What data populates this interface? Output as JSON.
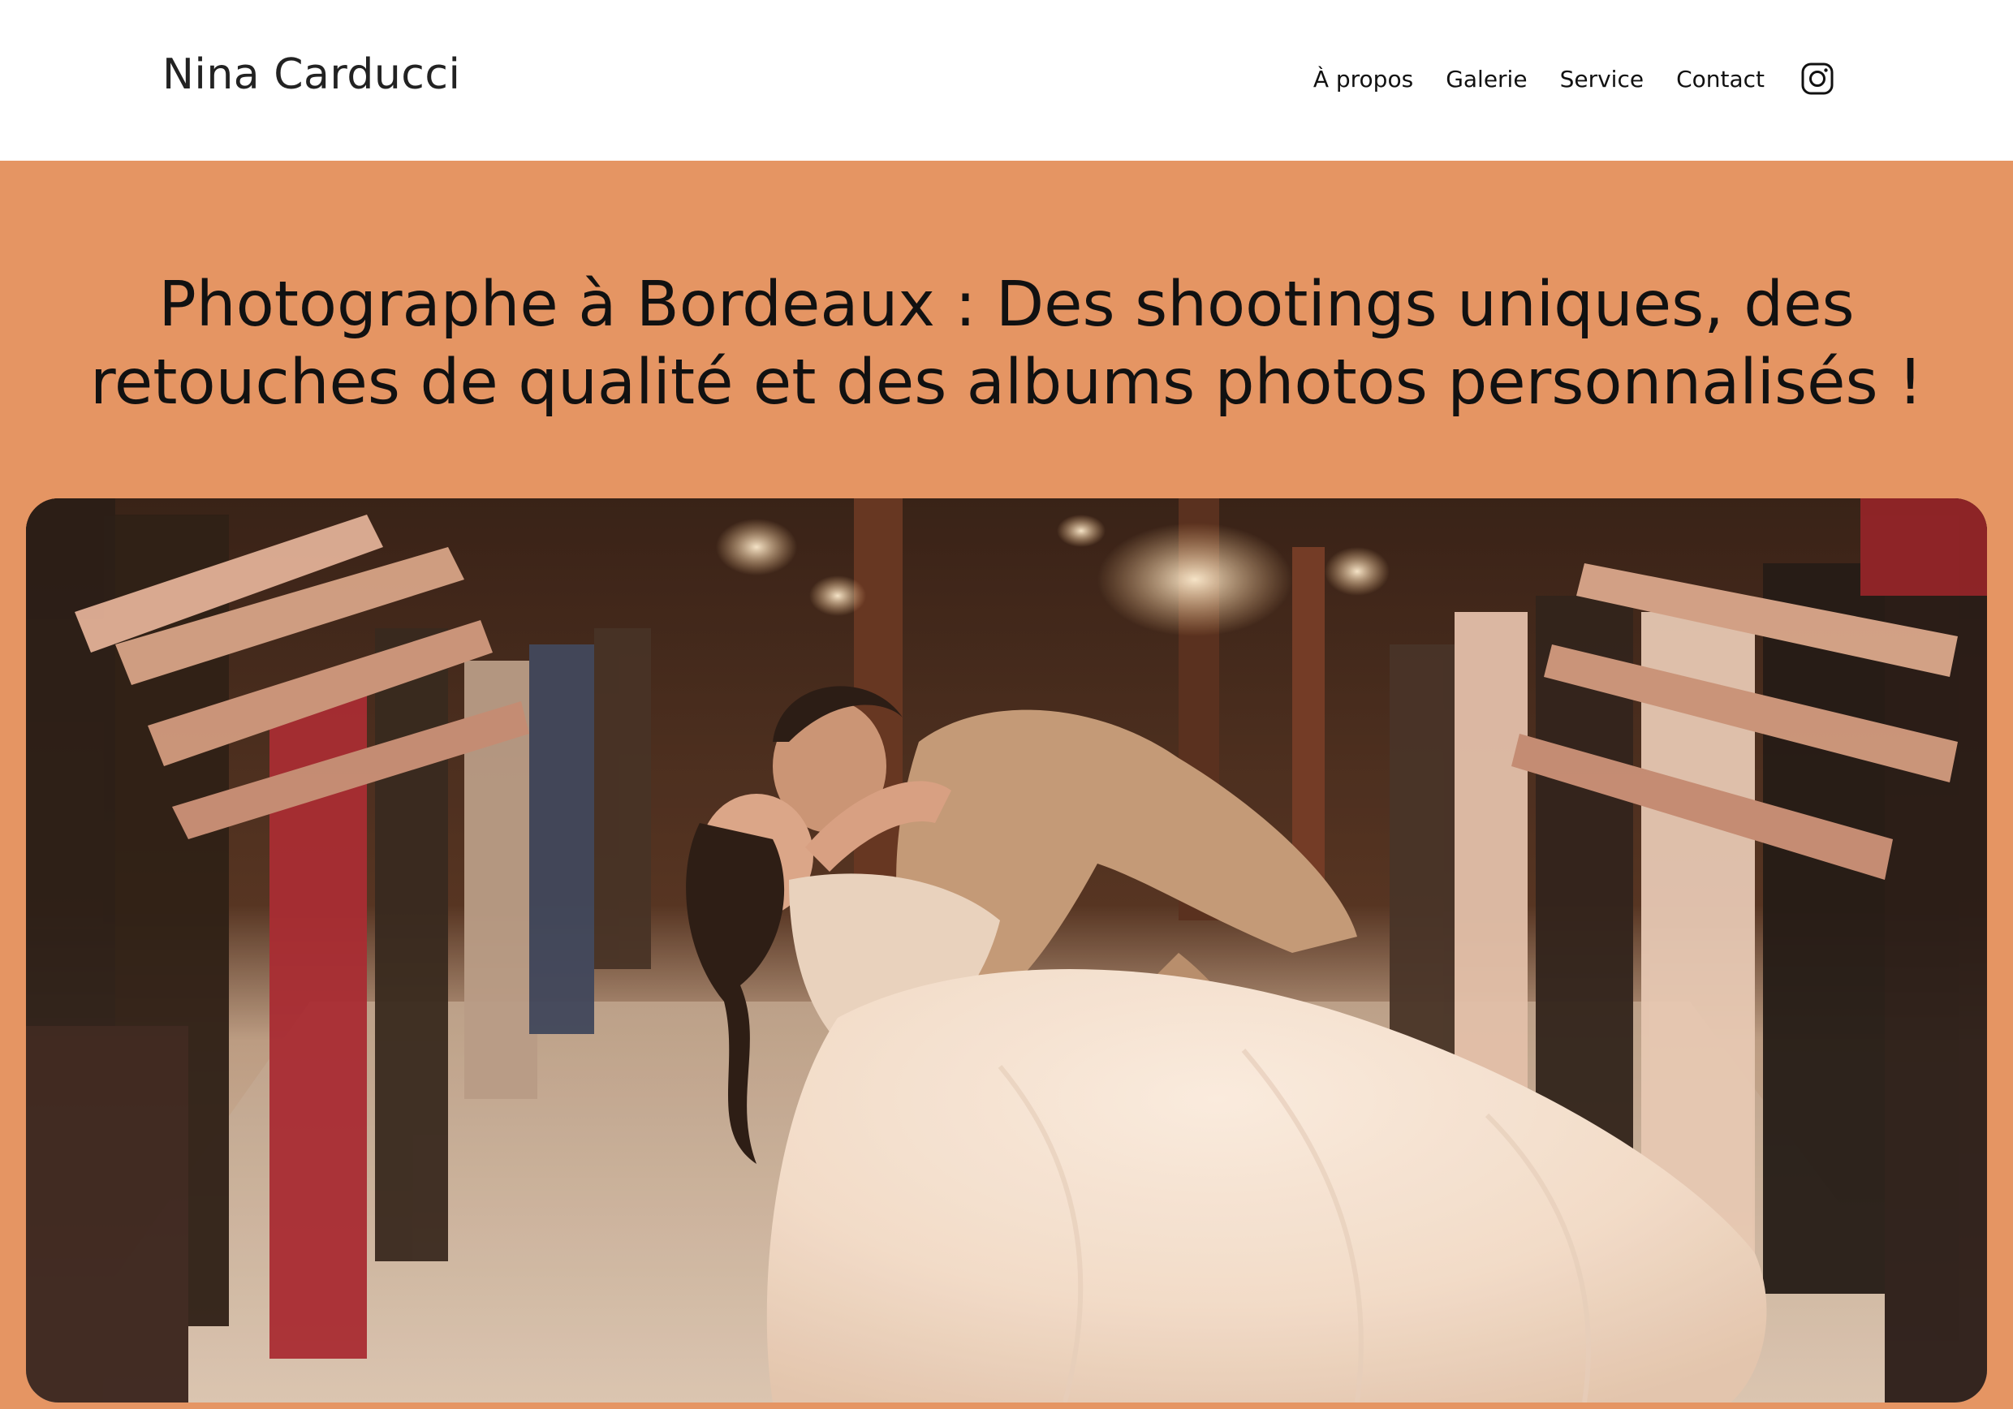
{
  "header": {
    "brand": "Nina Carducci",
    "nav": [
      {
        "label": "À propos"
      },
      {
        "label": "Galerie"
      },
      {
        "label": "Service"
      },
      {
        "label": "Contact"
      }
    ],
    "social_icon": "instagram-icon"
  },
  "hero": {
    "title": "Photographe à Bordeaux : Des shootings uniques, des retouches de qualité et des albums photos personnalisés !",
    "image_subject": "wedding-couple-kiss-photo"
  },
  "colors": {
    "header_bg": "#ffffff",
    "hero_bg": "#e59563",
    "text": "#111111"
  }
}
